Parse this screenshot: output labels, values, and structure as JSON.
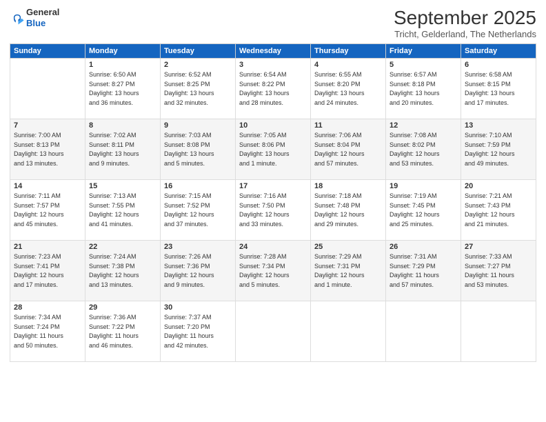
{
  "logo": {
    "general": "General",
    "blue": "Blue"
  },
  "header": {
    "month": "September 2025",
    "subtitle": "Tricht, Gelderland, The Netherlands"
  },
  "days_of_week": [
    "Sunday",
    "Monday",
    "Tuesday",
    "Wednesday",
    "Thursday",
    "Friday",
    "Saturday"
  ],
  "weeks": [
    [
      {
        "num": "",
        "info": ""
      },
      {
        "num": "1",
        "info": "Sunrise: 6:50 AM\nSunset: 8:27 PM\nDaylight: 13 hours\nand 36 minutes."
      },
      {
        "num": "2",
        "info": "Sunrise: 6:52 AM\nSunset: 8:25 PM\nDaylight: 13 hours\nand 32 minutes."
      },
      {
        "num": "3",
        "info": "Sunrise: 6:54 AM\nSunset: 8:22 PM\nDaylight: 13 hours\nand 28 minutes."
      },
      {
        "num": "4",
        "info": "Sunrise: 6:55 AM\nSunset: 8:20 PM\nDaylight: 13 hours\nand 24 minutes."
      },
      {
        "num": "5",
        "info": "Sunrise: 6:57 AM\nSunset: 8:18 PM\nDaylight: 13 hours\nand 20 minutes."
      },
      {
        "num": "6",
        "info": "Sunrise: 6:58 AM\nSunset: 8:15 PM\nDaylight: 13 hours\nand 17 minutes."
      }
    ],
    [
      {
        "num": "7",
        "info": "Sunrise: 7:00 AM\nSunset: 8:13 PM\nDaylight: 13 hours\nand 13 minutes."
      },
      {
        "num": "8",
        "info": "Sunrise: 7:02 AM\nSunset: 8:11 PM\nDaylight: 13 hours\nand 9 minutes."
      },
      {
        "num": "9",
        "info": "Sunrise: 7:03 AM\nSunset: 8:08 PM\nDaylight: 13 hours\nand 5 minutes."
      },
      {
        "num": "10",
        "info": "Sunrise: 7:05 AM\nSunset: 8:06 PM\nDaylight: 13 hours\nand 1 minute."
      },
      {
        "num": "11",
        "info": "Sunrise: 7:06 AM\nSunset: 8:04 PM\nDaylight: 12 hours\nand 57 minutes."
      },
      {
        "num": "12",
        "info": "Sunrise: 7:08 AM\nSunset: 8:02 PM\nDaylight: 12 hours\nand 53 minutes."
      },
      {
        "num": "13",
        "info": "Sunrise: 7:10 AM\nSunset: 7:59 PM\nDaylight: 12 hours\nand 49 minutes."
      }
    ],
    [
      {
        "num": "14",
        "info": "Sunrise: 7:11 AM\nSunset: 7:57 PM\nDaylight: 12 hours\nand 45 minutes."
      },
      {
        "num": "15",
        "info": "Sunrise: 7:13 AM\nSunset: 7:55 PM\nDaylight: 12 hours\nand 41 minutes."
      },
      {
        "num": "16",
        "info": "Sunrise: 7:15 AM\nSunset: 7:52 PM\nDaylight: 12 hours\nand 37 minutes."
      },
      {
        "num": "17",
        "info": "Sunrise: 7:16 AM\nSunset: 7:50 PM\nDaylight: 12 hours\nand 33 minutes."
      },
      {
        "num": "18",
        "info": "Sunrise: 7:18 AM\nSunset: 7:48 PM\nDaylight: 12 hours\nand 29 minutes."
      },
      {
        "num": "19",
        "info": "Sunrise: 7:19 AM\nSunset: 7:45 PM\nDaylight: 12 hours\nand 25 minutes."
      },
      {
        "num": "20",
        "info": "Sunrise: 7:21 AM\nSunset: 7:43 PM\nDaylight: 12 hours\nand 21 minutes."
      }
    ],
    [
      {
        "num": "21",
        "info": "Sunrise: 7:23 AM\nSunset: 7:41 PM\nDaylight: 12 hours\nand 17 minutes."
      },
      {
        "num": "22",
        "info": "Sunrise: 7:24 AM\nSunset: 7:38 PM\nDaylight: 12 hours\nand 13 minutes."
      },
      {
        "num": "23",
        "info": "Sunrise: 7:26 AM\nSunset: 7:36 PM\nDaylight: 12 hours\nand 9 minutes."
      },
      {
        "num": "24",
        "info": "Sunrise: 7:28 AM\nSunset: 7:34 PM\nDaylight: 12 hours\nand 5 minutes."
      },
      {
        "num": "25",
        "info": "Sunrise: 7:29 AM\nSunset: 7:31 PM\nDaylight: 12 hours\nand 1 minute."
      },
      {
        "num": "26",
        "info": "Sunrise: 7:31 AM\nSunset: 7:29 PM\nDaylight: 11 hours\nand 57 minutes."
      },
      {
        "num": "27",
        "info": "Sunrise: 7:33 AM\nSunset: 7:27 PM\nDaylight: 11 hours\nand 53 minutes."
      }
    ],
    [
      {
        "num": "28",
        "info": "Sunrise: 7:34 AM\nSunset: 7:24 PM\nDaylight: 11 hours\nand 50 minutes."
      },
      {
        "num": "29",
        "info": "Sunrise: 7:36 AM\nSunset: 7:22 PM\nDaylight: 11 hours\nand 46 minutes."
      },
      {
        "num": "30",
        "info": "Sunrise: 7:37 AM\nSunset: 7:20 PM\nDaylight: 11 hours\nand 42 minutes."
      },
      {
        "num": "",
        "info": ""
      },
      {
        "num": "",
        "info": ""
      },
      {
        "num": "",
        "info": ""
      },
      {
        "num": "",
        "info": ""
      }
    ]
  ]
}
